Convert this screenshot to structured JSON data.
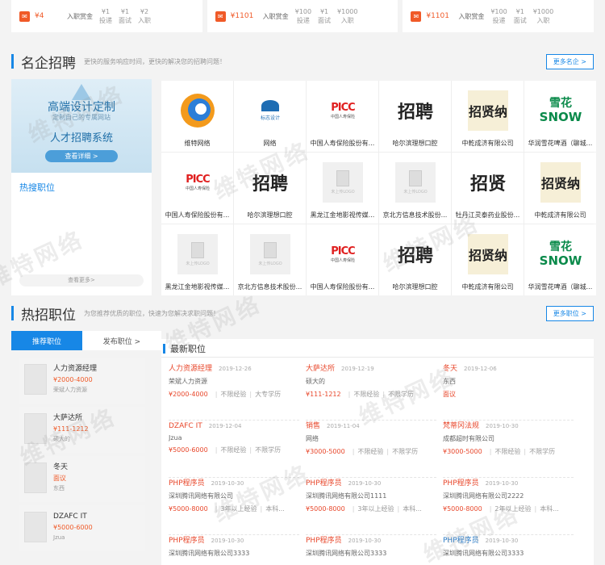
{
  "top_cards": [
    {
      "money": "¥4",
      "bonus": "入职赏金",
      "stats": [
        {
          "v": "¥1",
          "k": "投递"
        },
        {
          "v": "¥1",
          "k": "面试"
        },
        {
          "v": "¥2",
          "k": "入职"
        }
      ]
    },
    {
      "money": "¥1101",
      "bonus": "入职赏金",
      "stats": [
        {
          "v": "¥100",
          "k": "投递"
        },
        {
          "v": "¥1",
          "k": "面试"
        },
        {
          "v": "¥1000",
          "k": "入职"
        }
      ]
    },
    {
      "money": "¥1101",
      "bonus": "入职赏金",
      "stats": [
        {
          "v": "¥100",
          "k": "投递"
        },
        {
          "v": "¥1",
          "k": "面试"
        },
        {
          "v": "¥1000",
          "k": "入职"
        }
      ]
    }
  ],
  "companies_section": {
    "title": "名企招聘",
    "subtitle": "更快的服务响应时间，更快的解决您的招聘问题！",
    "more": "更多名企 >"
  },
  "ad": {
    "line1": "高端设计定制",
    "line2": "定制自己的专属网站",
    "line3": "人才招聘系统",
    "button": "查看详细 >"
  },
  "hot_left": {
    "label": "热搜职位",
    "more": "查看更多>"
  },
  "companies": [
    {
      "name": "维特网络",
      "logo": "swirl"
    },
    {
      "name": "网络",
      "logo": "biaozhi"
    },
    {
      "name": "中国人寿保险股份有...",
      "logo": "picc"
    },
    {
      "name": "哈尔滨理想口腔",
      "logo": "zhaopin"
    },
    {
      "name": "中乾成济有限公司",
      "logo": "dwork"
    },
    {
      "name": "华润雪花啤酒（聊城...",
      "logo": "snow"
    },
    {
      "name": "中国人寿保险股份有...",
      "logo": "picc"
    },
    {
      "name": "哈尔滨理想口腔",
      "logo": "zhaopin"
    },
    {
      "name": "黑龙江金地影视传媒...",
      "logo": "none"
    },
    {
      "name": "京北方信息技术股份...",
      "logo": "none"
    },
    {
      "name": "牡丹江灵泰药业股份...",
      "logo": "horse"
    },
    {
      "name": "中乾成济有限公司",
      "logo": "dwork"
    },
    {
      "name": "黑龙江金地影视传媒...",
      "logo": "none"
    },
    {
      "name": "京北方信息技术股份...",
      "logo": "none"
    },
    {
      "name": "中国人寿保险股份有...",
      "logo": "picc"
    },
    {
      "name": "哈尔滨理想口腔",
      "logo": "zhaopin"
    },
    {
      "name": "中乾成济有限公司",
      "logo": "dwork"
    },
    {
      "name": "华润雪花啤酒（聊城...",
      "logo": "snow"
    }
  ],
  "logo_text": {
    "picc": "PICC",
    "picc_sub": "中国人寿保险",
    "zhaopin": "招聘",
    "dwork": "招贤纳",
    "horse": "招贤",
    "snow_a": "雪花",
    "snow_b": "SNOW",
    "biaozhi": "标志设计",
    "none": "未上传LOGO"
  },
  "jobs_section": {
    "title": "热招职位",
    "subtitle": "为您推荐优质的职位，快速为您解决求职问题！",
    "more": "更多职位 >"
  },
  "tabs": [
    "推荐职位",
    "发布职位 >"
  ],
  "hot_jobs": [
    {
      "title": "人力资源经理",
      "salary": "¥2000-4000",
      "company": "荣斌人力资源"
    },
    {
      "title": "大萨达所",
      "salary": "¥111-1212",
      "company": "硕大的"
    },
    {
      "title": "冬天",
      "salary": "面议",
      "company": "东西"
    },
    {
      "title": "DZAFC IT",
      "salary": "¥5000-6000",
      "company": "Jzua"
    }
  ],
  "latest": {
    "title": "最新职位",
    "jobs": [
      {
        "title": "人力资源经理",
        "date": "2019-12-26",
        "company": "荣斌人力资源",
        "salary": "¥2000-4000",
        "exp": "不限经验",
        "edu": "大专学历",
        "blue": false
      },
      {
        "title": "大萨达所",
        "date": "2019-12-19",
        "company": "硕大的",
        "salary": "¥111-1212",
        "exp": "不限经验",
        "edu": "不限学历",
        "blue": false
      },
      {
        "title": "冬天",
        "date": "2019-12-06",
        "company": "东西",
        "salary": "面议",
        "exp": "",
        "edu": "",
        "blue": false
      },
      {
        "title": "DZAFC IT",
        "date": "2019-12-04",
        "company": "Jzua",
        "salary": "¥5000-6000",
        "exp": "不限经验",
        "edu": "不限学历",
        "blue": false
      },
      {
        "title": "销售",
        "date": "2019-11-04",
        "company": "网络",
        "salary": "¥3000-5000",
        "exp": "不限经验",
        "edu": "不限学历",
        "blue": false
      },
      {
        "title": "梵蒂冈法规",
        "date": "2019-10-30",
        "company": "成都超时有限公司",
        "salary": "¥3000-5000",
        "exp": "不限经验",
        "edu": "不限学历",
        "blue": false
      },
      {
        "title": "PHP程序员",
        "date": "2019-10-30",
        "company": "深圳腾讯网络有限公司",
        "salary": "¥5000-8000",
        "exp": "3年以上经验",
        "edu": "本科...",
        "blue": false
      },
      {
        "title": "PHP程序员",
        "date": "2019-10-30",
        "company": "深圳腾讯网络有限公司1111",
        "salary": "¥5000-8000",
        "exp": "3年以上经验",
        "edu": "本科...",
        "blue": false
      },
      {
        "title": "PHP程序员",
        "date": "2019-10-30",
        "company": "深圳腾讯网络有限公司2222",
        "salary": "¥5000-8000",
        "exp": "2年以上经验",
        "edu": "本科...",
        "blue": false
      },
      {
        "title": "PHP程序员",
        "date": "2019-10-30",
        "company": "深圳腾讯网络有限公司3333",
        "salary": "",
        "exp": "",
        "edu": "",
        "blue": false
      },
      {
        "title": "PHP程序员",
        "date": "2019-10-30",
        "company": "深圳腾讯网络有限公司3333",
        "salary": "",
        "exp": "",
        "edu": "",
        "blue": false
      },
      {
        "title": "PHP程序员",
        "date": "2019-10-30",
        "company": "深圳腾讯网络有限公司3333",
        "salary": "",
        "exp": "",
        "edu": "",
        "blue": true
      }
    ]
  },
  "watermark": "维特网络"
}
